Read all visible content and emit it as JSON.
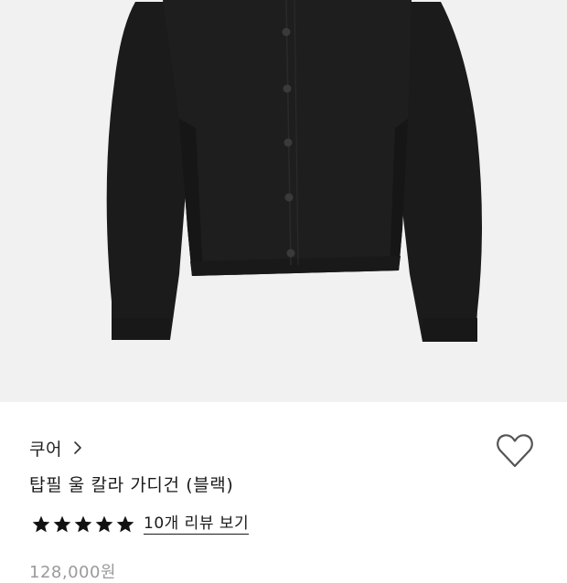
{
  "product": {
    "brand": "쿠어",
    "title": "탑필 울 칼라 가디건 (블랙)",
    "rating_stars": 5,
    "review_link": "10개 리뷰 보기",
    "price": "128,000원"
  },
  "icons": {
    "brand_chevron": "chevron-right-icon",
    "wishlist": "heart-outline-icon",
    "star": "star-filled-icon"
  },
  "colors": {
    "image_background": "#f1f1f1",
    "garment": "#1c1c1c",
    "star": "#111111",
    "price": "#9a9a9a"
  }
}
